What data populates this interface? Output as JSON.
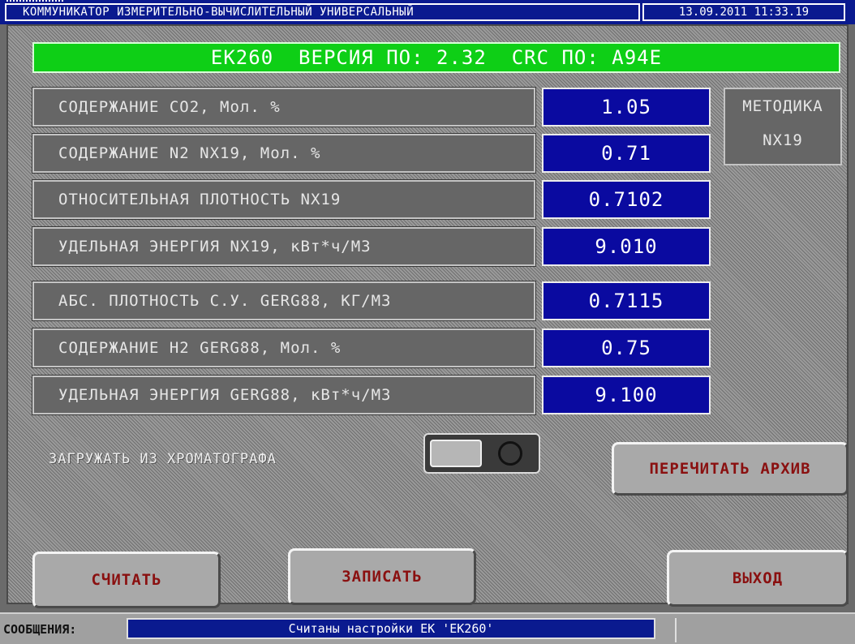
{
  "header": {
    "title": "КОММУНИКАТОР ИЗМЕРИТЕЛЬНО-ВЫЧИСЛИТЕЛЬНЫЙ УНИВЕРСАЛЬНЫЙ",
    "datetime": "13.09.2011 11:33.19"
  },
  "banner": {
    "text": "EK260  ВЕРСИЯ ПО: 2.32  CRC ПО: A94E"
  },
  "parameters": [
    {
      "label": "СОДЕРЖАНИЕ СО2, Мол. %",
      "value": "1.05"
    },
    {
      "label": "СОДЕРЖАНИЕ N2 NX19, Мол. %",
      "value": "0.71"
    },
    {
      "label": "ОТНОСИТЕЛЬНАЯ ПЛОТНОСТЬ NX19",
      "value": "0.7102"
    },
    {
      "label": "УДЕЛЬНАЯ ЭНЕРГИЯ NX19, кВт*ч/М3",
      "value": "9.010"
    },
    {
      "label": "АБС. ПЛОТНОСТЬ С.У. GERG88, КГ/М3",
      "value": "0.7115"
    },
    {
      "label": "СОДЕРЖАНИЕ Н2 GERG88, Мол. %",
      "value": "0.75"
    },
    {
      "label": "УДЕЛЬНАЯ ЭНЕРГИЯ GERG88, кВт*ч/М3",
      "value": "9.100"
    }
  ],
  "method": {
    "title": "МЕТОДИКА",
    "value": "NX19"
  },
  "load_from_chromatograph": {
    "label": "ЗАГРУЖАТЬ ИЗ ХРОМАТОГРАФА",
    "enabled": false
  },
  "buttons": {
    "reread_archive": "ПЕРЕЧИТАТЬ АРХИВ",
    "read": "СЧИТАТЬ",
    "write": "ЗАПИСАТЬ",
    "exit": "ВЫХОД"
  },
  "statusbar": {
    "label": "СООБЩЕНИЯ:",
    "message": "Считаны настройки ЕК 'ЕК260'"
  },
  "colors": {
    "title_bar": "#0a1a8f",
    "banner": "#0ecf16",
    "value_box": "#0a0aa0",
    "button_text": "#8a1010"
  }
}
